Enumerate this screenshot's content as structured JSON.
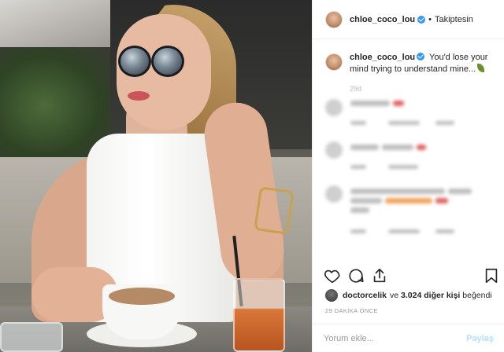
{
  "post": {
    "username": "chloe_coco_lou",
    "follow_status": "Takiptesin",
    "separator": "•",
    "caption": "You'd lose your mind trying to understand mine...",
    "caption_time": "29d",
    "icons": {
      "verified": "verified-badge-icon",
      "caption_emoji": "leaf-emoji-icon",
      "like": "heart-icon",
      "comment": "comment-bubble-icon",
      "share": "share-icon",
      "save": "bookmark-icon"
    }
  },
  "likes": {
    "liker": "doctorcelik",
    "connector": "ve",
    "count_text": "3.024 diğer kişi",
    "suffix": "beğendi"
  },
  "posted_time": "29 DAKİKA ÖNCE",
  "comment_box": {
    "placeholder": "Yorum ekle...",
    "post_label": "Paylaş"
  },
  "colors": {
    "accent": "#3897f0",
    "text": "#262626",
    "muted": "#999999",
    "post_button_disabled": "#b2dffc"
  }
}
